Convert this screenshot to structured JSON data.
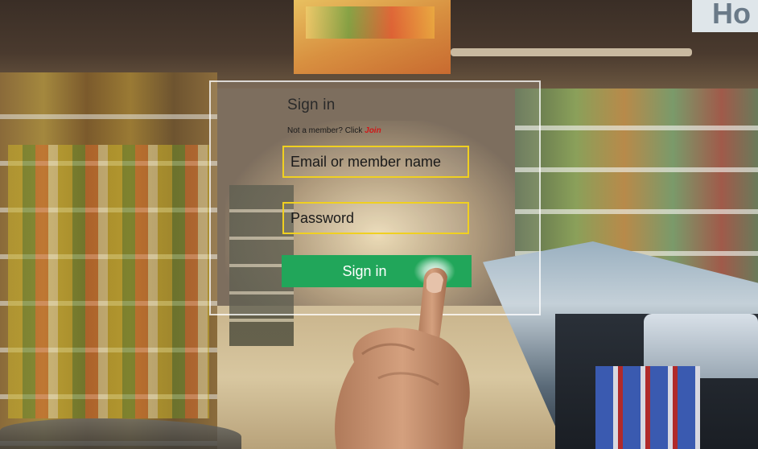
{
  "login": {
    "title": "Sign in",
    "member_prompt": "Not a member? Click ",
    "join_label": "Join",
    "email_placeholder": "Email or member name",
    "password_placeholder": "Password",
    "signin_label": "Sign in"
  },
  "background": {
    "store_sign_text": "Ho"
  },
  "colors": {
    "button": "#21a65a",
    "field_border": "#f0d020",
    "join_link": "#d01818"
  }
}
